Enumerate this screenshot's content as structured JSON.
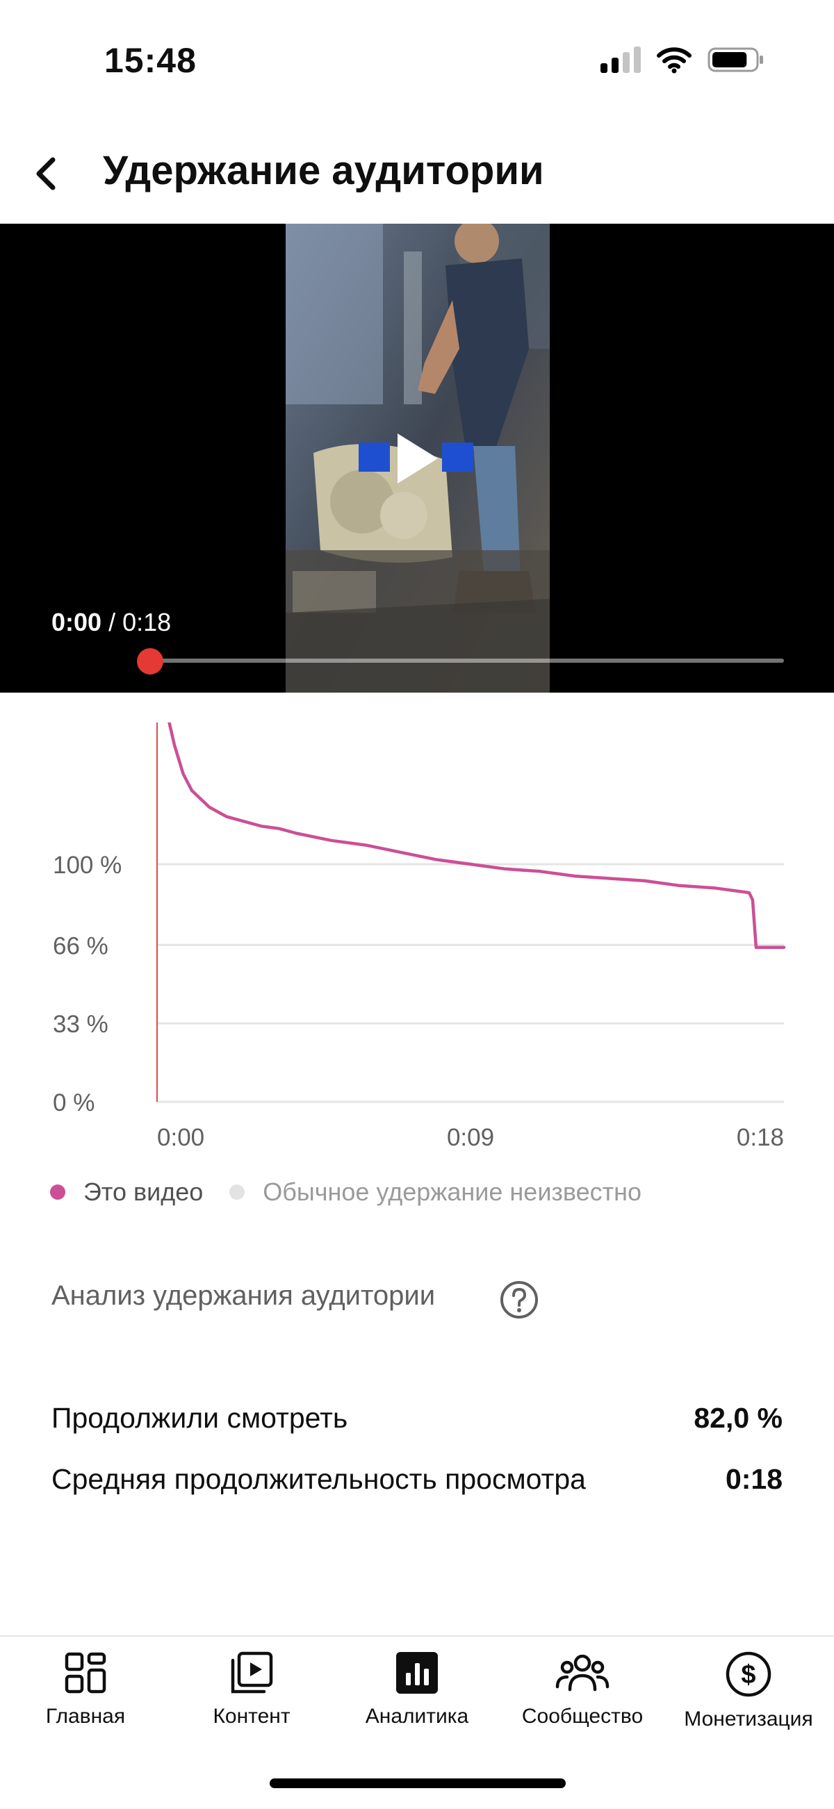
{
  "status_bar": {
    "time": "15:48",
    "battery_level": 0.85
  },
  "header": {
    "title": "Удержание аудитории",
    "back_icon": "chevron-left-icon"
  },
  "player": {
    "current_time": "0:00",
    "separator": "/",
    "duration": "0:18",
    "progress": 0.0,
    "play_icon": "play-icon"
  },
  "chart_data": {
    "type": "line",
    "y_tick_labels": [
      "100 %",
      "66 %",
      "33 %",
      "0 %"
    ],
    "x_tick_labels": [
      "0:00",
      "0:09",
      "0:18"
    ],
    "xlim": [
      0,
      18
    ],
    "series": [
      {
        "name": "Это видео",
        "color": "#cc4f96",
        "x": [
          0,
          0.25,
          0.5,
          0.75,
          1.0,
          1.5,
          2.0,
          2.5,
          3.0,
          3.5,
          4.0,
          5.0,
          6.0,
          7.0,
          8.0,
          9.0,
          10.0,
          11.0,
          12.0,
          13.0,
          14.0,
          15.0,
          16.0,
          17.0,
          17.1,
          17.2,
          17.5,
          18.0
        ],
        "y": [
          178,
          166,
          150,
          138,
          131,
          124,
          120,
          118,
          116,
          115,
          113,
          110,
          108,
          105,
          102,
          100,
          98,
          97,
          95,
          94,
          93,
          91,
          90,
          88,
          85,
          65,
          65,
          65
        ]
      },
      {
        "name": "Обычное удержание неизвестно",
        "color": "#e0e0e0",
        "x": [],
        "y": []
      }
    ],
    "legend_position": "bottom-left",
    "grid": true
  },
  "legend": {
    "this_video": "Это видео",
    "typical": "Обычное удержание неизвестно",
    "this_video_color": "#cc4f96",
    "typical_color": "#e3e3e3"
  },
  "analysis": {
    "title": "Анализ удержания аудитории",
    "help_icon": "question-circle-icon",
    "metrics": [
      {
        "label": "Продолжили смотреть",
        "value": "82,0 %"
      },
      {
        "label": "Средняя продолжительность просмотра",
        "value": "0:18"
      }
    ]
  },
  "bottom_nav": {
    "items": [
      {
        "label": "Главная",
        "icon": "dashboard-grid-icon",
        "active": false
      },
      {
        "label": "Контент",
        "icon": "video-content-icon",
        "active": false
      },
      {
        "label": "Аналитика",
        "icon": "analytics-bar-chart-icon",
        "active": true
      },
      {
        "label": "Сообщество",
        "icon": "community-people-icon",
        "active": false
      },
      {
        "label": "Монетизация",
        "icon": "monetization-dollar-icon",
        "active": false
      }
    ]
  }
}
